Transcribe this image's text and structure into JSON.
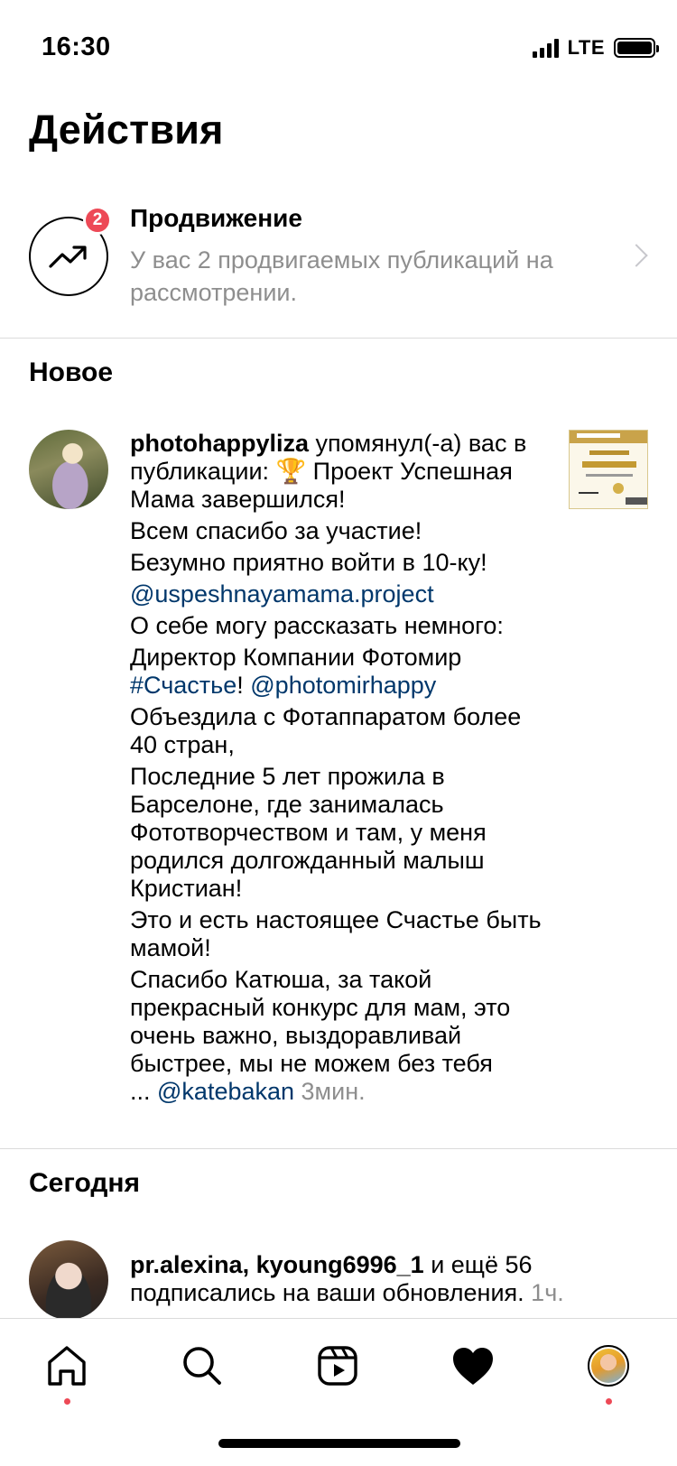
{
  "status_bar": {
    "time": "16:30",
    "network": "LTE"
  },
  "header": {
    "title": "Действия"
  },
  "promotion": {
    "title": "Продвижение",
    "subtitle": "У вас 2 продвигаемых публикаций на рассмотрении.",
    "badge_count": "2"
  },
  "sections": {
    "new": "Новое",
    "today": "Сегодня"
  },
  "mention_notification": {
    "username": "photohappyliza",
    "action": " упомянул(-а) вас в публикации: 🏆 Проект Успешная Мама завершился!",
    "lines": [
      "Всем спасибо за участие!",
      "Безумно приятно войти в 10-ку!"
    ],
    "mention_1": "@uspeshnayamama.project",
    "line_about": "О себе могу рассказать немного:",
    "line_director": "Директор  Компании  Фотомир",
    "hashtag": "#Счастье",
    "exclaim": "! ",
    "mention_2": "@photomirhappy",
    "lines_2": [
      "Объездила с Фотаппаратом более 40 стран,",
      "Последние 5 лет прожила в Барселоне, где занималась Фототворчеством и там, у меня родился долгожданный малыш Кристиан!",
      "Это и есть настоящее Счастье быть мамой!",
      "Спасибо Катюша, за такой прекрасный конкурс для мам, это очень важно, выздоравливай быстрее, мы не можем без тебя"
    ],
    "ellipsis": "... ",
    "mention_3": "@katebakan",
    "time": " 3мин."
  },
  "follow_notification": {
    "usernames": "pr.alexina, kyoung6996_1",
    "action": " и ещё 56 подписались на ваши обновления.",
    "time": " 1ч."
  },
  "tab_bar": {
    "items": [
      "home-icon",
      "search-icon",
      "reels-icon",
      "heart-icon",
      "profile-avatar"
    ],
    "active": "heart-icon"
  },
  "colors": {
    "badge": "#ed4956",
    "mention": "#00376b",
    "secondary_text": "#8e8e8e"
  }
}
